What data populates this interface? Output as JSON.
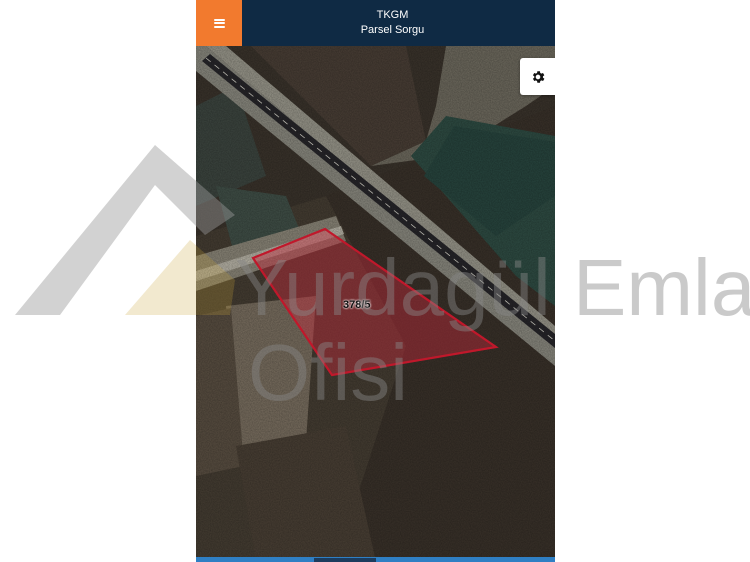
{
  "header": {
    "title": "TKGM",
    "subtitle": "Parsel Sorgu"
  },
  "menu": {
    "icon": "hamburger-menu-icon"
  },
  "settings": {
    "icon": "gear-icon"
  },
  "map": {
    "parcel_label": "378/5",
    "parcel_color": "#c0182b"
  },
  "watermark": {
    "text_line1": "Yurdagül Emlak",
    "text_line2": "Ofisi"
  },
  "colors": {
    "header_bg": "#0f2a44",
    "menu_bg": "#f27a2e",
    "bottom_bar": "#2f7fc4"
  }
}
